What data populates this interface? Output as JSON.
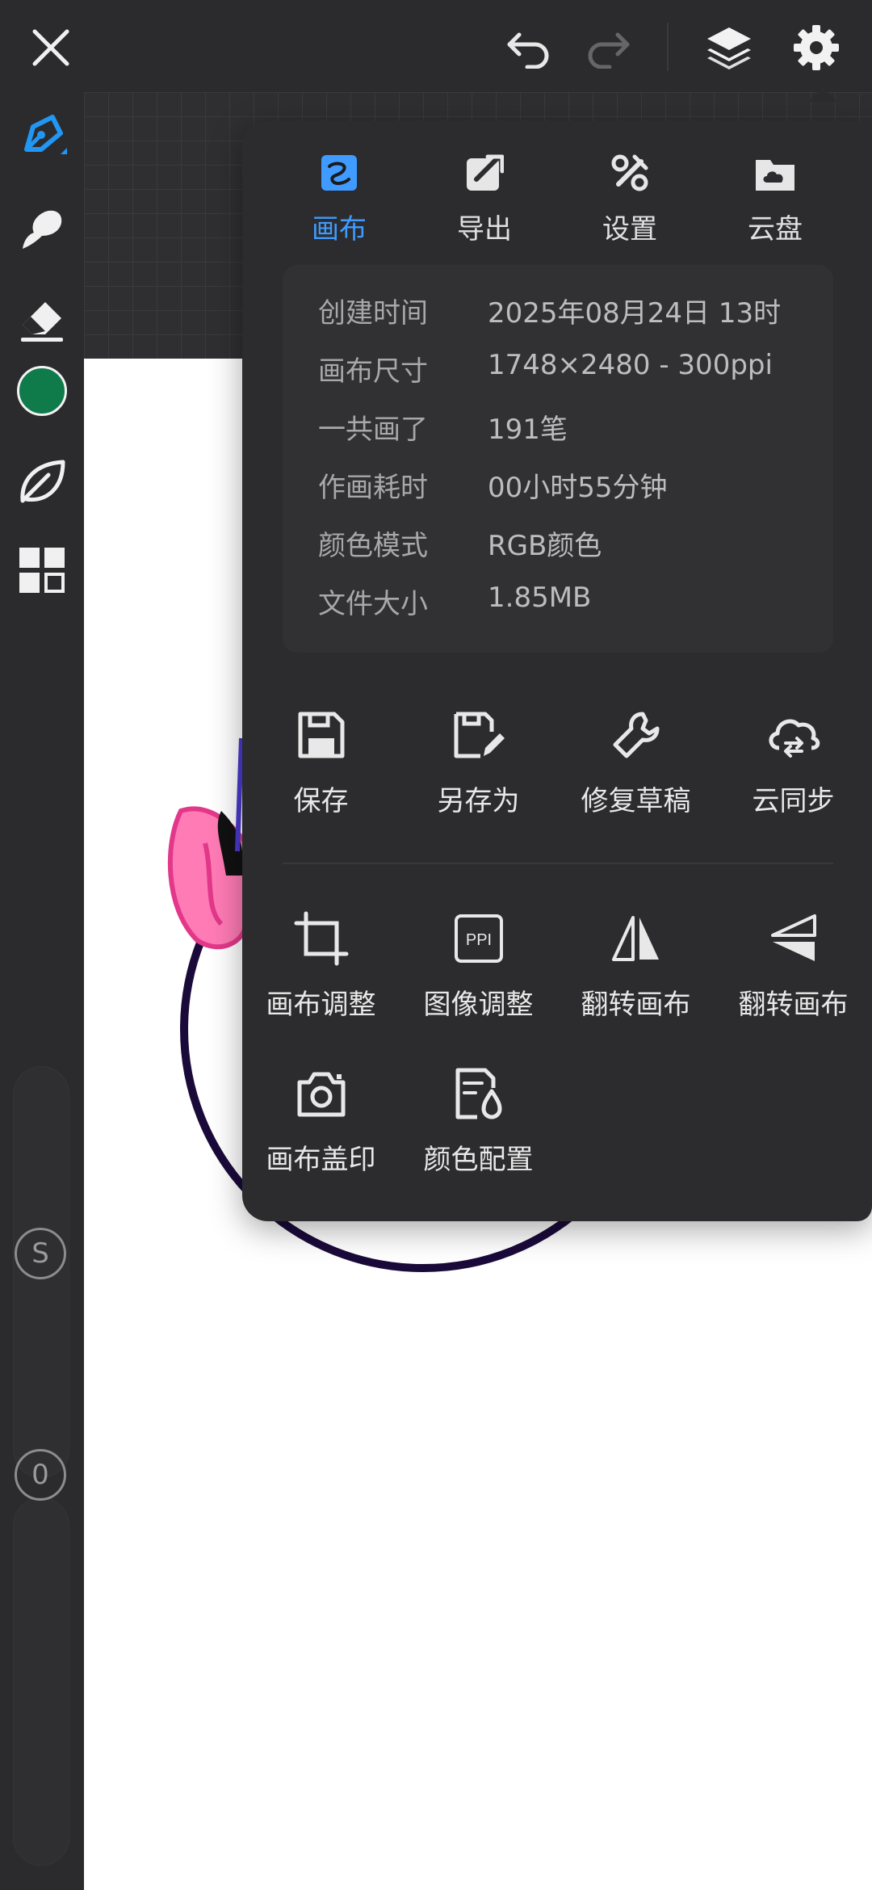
{
  "toolbar": {
    "icons": [
      "close-icon",
      "undo-icon",
      "redo-icon",
      "layers-icon",
      "gear-icon"
    ]
  },
  "left_toolbar": {
    "tools": [
      "pen-icon",
      "smudge-icon",
      "eraser-icon",
      "color-swatch",
      "leaf-icon",
      "grid-icon"
    ],
    "current_color": "#0f7a4a",
    "size_slider_label": "S",
    "opacity_slider_label": "0"
  },
  "settings_panel": {
    "tabs": [
      {
        "label": "画布",
        "icon": "canvas-icon",
        "active": true
      },
      {
        "label": "导出",
        "icon": "export-icon",
        "active": false
      },
      {
        "label": "设置",
        "icon": "tools-icon",
        "active": false
      },
      {
        "label": "云盘",
        "icon": "cloud-folder-icon",
        "active": false
      }
    ],
    "info": [
      {
        "key": "创建时间",
        "value": "2025年08月24日 13时"
      },
      {
        "key": "画布尺寸",
        "value": "1748×2480 - 300ppi"
      },
      {
        "key": "一共画了",
        "value": "191笔"
      },
      {
        "key": "作画耗时",
        "value": "00小时55分钟"
      },
      {
        "key": "颜色模式",
        "value": "RGB颜色"
      },
      {
        "key": "文件大小",
        "value": "1.85MB"
      }
    ],
    "actions_row1": [
      {
        "label": "保存",
        "icon": "save-icon"
      },
      {
        "label": "另存为",
        "icon": "save-as-icon"
      },
      {
        "label": "修复草稿",
        "icon": "wrench-icon"
      },
      {
        "label": "云同步",
        "icon": "cloud-sync-icon"
      }
    ],
    "actions_row2": [
      {
        "label": "画布调整",
        "icon": "crop-icon"
      },
      {
        "label": "图像调整",
        "icon": "ppi-icon",
        "icon_text": "PPI"
      },
      {
        "label": "翻转画布",
        "icon": "flip-horizontal-icon"
      },
      {
        "label": "翻转画布",
        "icon": "flip-vertical-icon"
      }
    ],
    "actions_row3": [
      {
        "label": "画布盖印",
        "icon": "camera-icon"
      },
      {
        "label": "颜色配置",
        "icon": "color-profile-icon"
      }
    ]
  },
  "colors": {
    "accent": "#3f9bff",
    "panel_bg": "#2c2c2e",
    "app_bg": "#2b2b2d"
  }
}
